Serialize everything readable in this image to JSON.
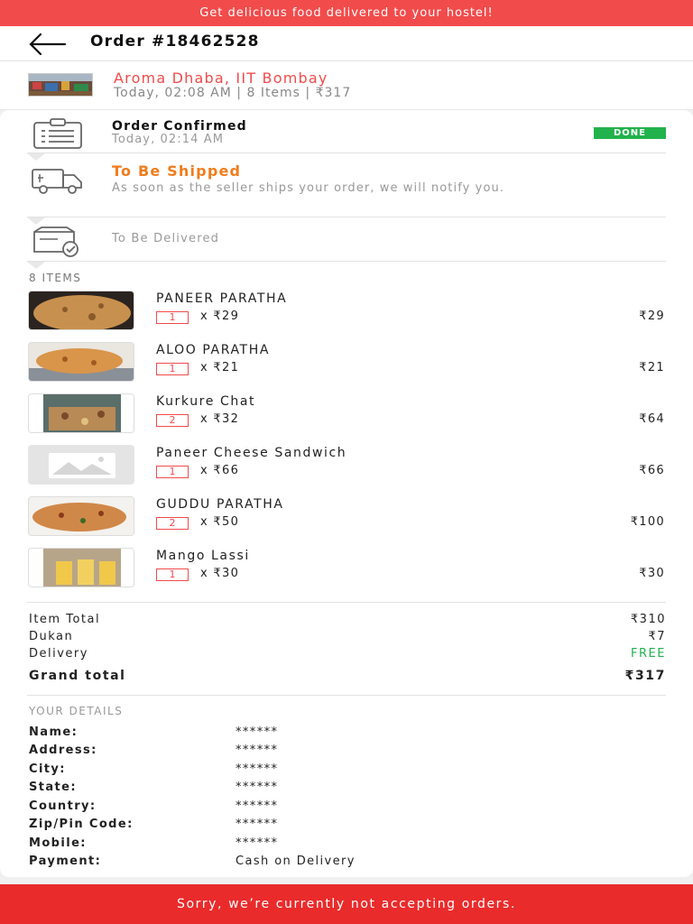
{
  "top_banner": {
    "text": "Get delicious food delivered to your hostel!"
  },
  "header": {
    "title": "Order #18462528"
  },
  "shop": {
    "name": "Aroma Dhaba, IIT Bombay",
    "meta": "Today, 02:08 AM | 8 Items | ₹317"
  },
  "tracking": {
    "steps": [
      {
        "title": "Order Confirmed",
        "subtitle": "Today, 02:14 AM",
        "badge": "DONE",
        "icon": "clipboard-icon"
      },
      {
        "title": "To Be Shipped",
        "subtitle": "As soon as the seller ships your order, we will notify you.",
        "icon": "truck-icon"
      },
      {
        "title": "To Be Delivered",
        "icon": "package-check-icon"
      }
    ]
  },
  "items_heading": "8 ITEMS",
  "items": [
    {
      "name": "PANEER PARATHA",
      "qty": "1",
      "unit": "x ₹29",
      "total": "₹29"
    },
    {
      "name": "ALOO PARATHA",
      "qty": "1",
      "unit": "x ₹21",
      "total": "₹21"
    },
    {
      "name": "Kurkure Chat",
      "qty": "2",
      "unit": "x ₹32",
      "total": "₹64"
    },
    {
      "name": "Paneer Cheese Sandwich",
      "qty": "1",
      "unit": "x ₹66",
      "total": "₹66"
    },
    {
      "name": "GUDDU PARATHA",
      "qty": "2",
      "unit": "x ₹50",
      "total": "₹100"
    },
    {
      "name": "Mango Lassi",
      "qty": "1",
      "unit": "x ₹30",
      "total": "₹30"
    }
  ],
  "summary": {
    "item_total_label": "Item Total",
    "item_total": "₹310",
    "dukan_label": "Dukan",
    "dukan": "₹7",
    "delivery_label": "Delivery",
    "delivery": "FREE",
    "grand_label": "Grand total",
    "grand": "₹317"
  },
  "details": {
    "heading": "YOUR DETAILS",
    "rows": [
      {
        "label": "Name:",
        "value": "******"
      },
      {
        "label": "Address:",
        "value": "******"
      },
      {
        "label": "City:",
        "value": "******"
      },
      {
        "label": "State:",
        "value": "******"
      },
      {
        "label": "Country:",
        "value": "******"
      },
      {
        "label": "Zip/Pin Code:",
        "value": "******"
      },
      {
        "label": "Mobile:",
        "value": "******"
      },
      {
        "label": "Payment:",
        "value": "Cash on Delivery"
      }
    ]
  },
  "bottom_banner": {
    "text": "Sorry, we’re currently not accepting orders."
  },
  "colors": {
    "brand_red": "#f24b4b",
    "step_orange": "#f07c1c",
    "success_green": "#22b24c"
  }
}
